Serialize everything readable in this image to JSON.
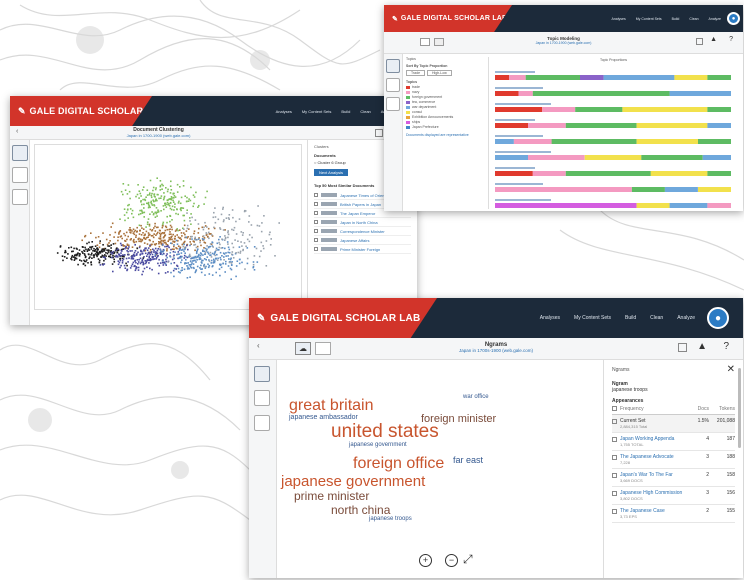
{
  "background": {
    "deco_color": "#c9c9c9"
  },
  "colors": {
    "header": "#1c2a3a",
    "brand_red": "#d2342a",
    "link": "#2a6fb1",
    "cloud_red": "#c8552e",
    "cloud_blue": "#34588f"
  },
  "w1": {
    "logo": "GALE DIGITAL SCHOLAR LAB",
    "nav": [
      "Analyses",
      "My Content Sets",
      "Build",
      "Clean",
      "Analyze"
    ],
    "title": "Document Clustering",
    "subtitle": "Japan in 1700-1900 (web.gale.com)",
    "panel": {
      "header": "Clusters",
      "heading": "Documents",
      "option": "Cluster 6 Group",
      "button": "Next Analysis",
      "section": "Top 50 Most Similar Documents",
      "rows": [
        "Japanese Times of Orien...",
        "British Papers in Japan",
        "The Japan Emperor",
        "Japan in North China",
        "Correspondence Minister",
        "Japanese Affairs",
        "Prime Minister Foreign"
      ]
    }
  },
  "w2": {
    "logo": "GALE DIGITAL SCHOLAR LAB",
    "nav": [
      "Analyses",
      "My Content Sets",
      "Build",
      "Clean",
      "Analyze"
    ],
    "title": "Topic Modeling",
    "subtitle": "Japan in 1700-1900 (web.gale.com)",
    "chart_title": "Topic Proportions",
    "legend": [
      {
        "label": "trade",
        "color": "#e03a2e"
      },
      {
        "label": "navy",
        "color": "#f49ac1"
      },
      {
        "label": "foreign government",
        "color": "#5dbb63"
      },
      {
        "label": "tea, commerce",
        "color": "#8a63c9"
      },
      {
        "label": "war department",
        "color": "#6fa8dc"
      },
      {
        "label": "consul",
        "color": "#f2e14c"
      },
      {
        "label": "Exhibition Announcements",
        "color": "#e9a23b"
      },
      {
        "label": "ships",
        "color": "#d45de0"
      },
      {
        "label": "Japan Prefecture",
        "color": "#3f87c7"
      }
    ]
  },
  "w3": {
    "logo": "GALE DIGITAL SCHOLAR LAB",
    "nav": [
      "Analyses",
      "My Content Sets",
      "Build",
      "Clean",
      "Analyze"
    ],
    "title": "Ngrams",
    "subtitle": "Japan in 1700s-1900 (web.gale.com)",
    "cloud": {
      "big": [
        {
          "text": "united states",
          "color": "#c8552e"
        },
        {
          "text": "great britain",
          "color": "#c8552e"
        },
        {
          "text": "foreign office",
          "color": "#c8552e"
        },
        {
          "text": "japanese government",
          "color": "#c8552e"
        },
        {
          "text": "foreign minister",
          "color": "#7a4b3a"
        },
        {
          "text": "prime minister",
          "color": "#7a4b3a"
        },
        {
          "text": "north china",
          "color": "#7a4b3a"
        },
        {
          "text": "far east",
          "color": "#34588f"
        },
        {
          "text": "japanese ambassador",
          "color": "#34588f"
        },
        {
          "text": "japanese troops",
          "color": "#34588f"
        },
        {
          "text": "japanese government",
          "color": "#34588f"
        },
        {
          "text": "war office",
          "color": "#34588f"
        }
      ]
    },
    "panel": {
      "header": "Ngrams",
      "term": "Ngram",
      "term_value": "japanese troops",
      "section": "Appearances",
      "cols": [
        "Frequency",
        "Docs",
        "Tokens"
      ],
      "rows": [
        {
          "title": "Current Set",
          "sub": "2,884,315 Total",
          "a": "1.5%",
          "b": "201,088"
        },
        {
          "title": "Japan Working Appenda",
          "sub": "1,755 TOTAL",
          "a": "4",
          "b": "187"
        },
        {
          "title": "The Japanese Advocate",
          "sub": "7,228",
          "a": "3",
          "b": "188"
        },
        {
          "title": "Japan's War To The Far",
          "sub": "3,669 DOCS",
          "a": "2",
          "b": "158"
        },
        {
          "title": "Japanese High Commission",
          "sub": "3,802 DOCS",
          "a": "3",
          "b": "156"
        },
        {
          "title": "The Japanese Case",
          "sub": "3,73 EPS",
          "a": "2",
          "b": "155"
        }
      ]
    }
  }
}
